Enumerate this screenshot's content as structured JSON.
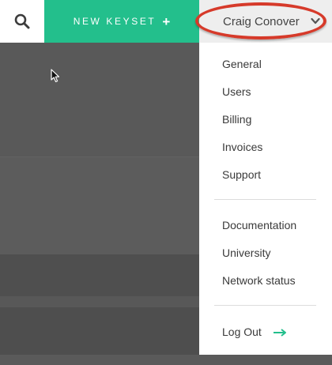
{
  "topbar": {
    "search_icon": "search-icon",
    "new_keyset_label": "NEW KEYSET",
    "new_keyset_icon": "+",
    "user_name": "Craig Conover",
    "user_chevron_icon": "chevron-down-icon"
  },
  "menu": {
    "account_items": [
      "General",
      "Users",
      "Billing",
      "Invoices",
      "Support"
    ],
    "resource_items": [
      "Documentation",
      "University",
      "Network status"
    ],
    "logout_label": "Log Out",
    "logout_icon": "arrow-right-icon"
  },
  "colors": {
    "accent": "#23bf8c",
    "highlight": "#d63a2a",
    "backdrop": "#5a5a5a"
  }
}
